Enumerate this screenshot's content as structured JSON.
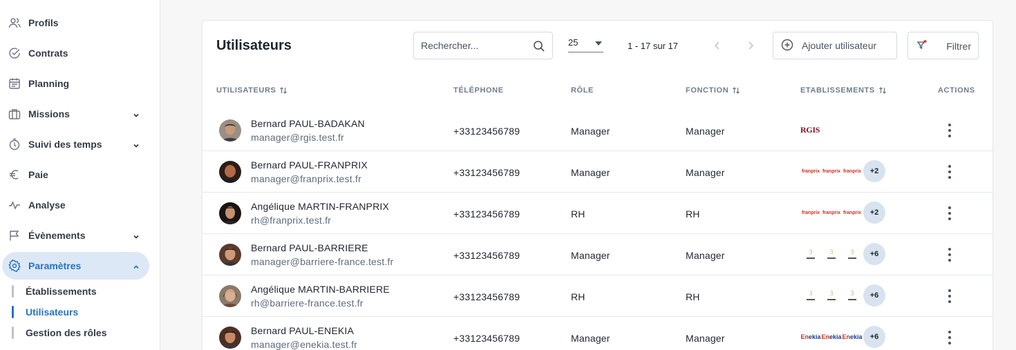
{
  "sidebar": {
    "items": [
      {
        "label": "Profils",
        "icon": "users-icon"
      },
      {
        "label": "Contrats",
        "icon": "check-circle-icon"
      },
      {
        "label": "Planning",
        "icon": "calendar-icon"
      },
      {
        "label": "Missions",
        "icon": "briefcase-icon",
        "expandable": true
      },
      {
        "label": "Suivi des temps",
        "icon": "timer-icon",
        "expandable": true
      },
      {
        "label": "Paie",
        "icon": "euro-icon"
      },
      {
        "label": "Analyse",
        "icon": "activity-icon"
      },
      {
        "label": "Évènements",
        "icon": "flag-icon",
        "expandable": true
      },
      {
        "label": "Paramètres",
        "icon": "gear-icon",
        "expandable": true,
        "active": true
      }
    ],
    "subitems": [
      {
        "label": "Établissements"
      },
      {
        "label": "Utilisateurs",
        "active": true
      },
      {
        "label": "Gestion des rôles"
      }
    ]
  },
  "header": {
    "title": "Utilisateurs",
    "search_placeholder": "Rechercher...",
    "per_page": "25",
    "range": "1 - 17 sur 17",
    "add_label": "Ajouter utilisateur",
    "filter_label": "Filtrer"
  },
  "table": {
    "columns": {
      "users": "UTILISATEURS",
      "phone": "TÉLÉPHONE",
      "role": "RÔLE",
      "function": "FONCTION",
      "establishments": "ETABLISSEMENTS",
      "actions": "ACTIONS"
    },
    "rows": [
      {
        "name": "Bernard PAUL-BADAKAN",
        "email": "manager@rgis.test.fr",
        "phone": "+33123456789",
        "role": "Manager",
        "function": "Manager",
        "logo": "RGIS",
        "extra": ""
      },
      {
        "name": "Bernard PAUL-FRANPRIX",
        "email": "manager@franprix.test.fr",
        "phone": "+33123456789",
        "role": "Manager",
        "function": "Manager",
        "logo": "franprix",
        "extra": "+2"
      },
      {
        "name": "Angélique MARTIN-FRANPRIX",
        "email": "rh@franprix.test.fr",
        "phone": "+33123456789",
        "role": "RH",
        "function": "RH",
        "logo": "franprix",
        "extra": "+2"
      },
      {
        "name": "Bernard PAUL-BARRIERE",
        "email": "manager@barriere-france.test.fr",
        "phone": "+33123456789",
        "role": "Manager",
        "function": "Manager",
        "logo": "barriere",
        "extra": "+6"
      },
      {
        "name": "Angélique MARTIN-BARRIERE",
        "email": "rh@barriere-france.test.fr",
        "phone": "+33123456789",
        "role": "RH",
        "function": "RH",
        "logo": "barriere",
        "extra": "+6"
      },
      {
        "name": "Bernard PAUL-ENEKIA",
        "email": "manager@enekia.test.fr",
        "phone": "+33123456789",
        "role": "Manager",
        "function": "Manager",
        "logo": "enekia",
        "extra": "+6"
      }
    ]
  },
  "colors": {
    "accent": "#2374c6",
    "active_bg": "#dde8f6",
    "badge_bg": "#d8e3ef"
  }
}
